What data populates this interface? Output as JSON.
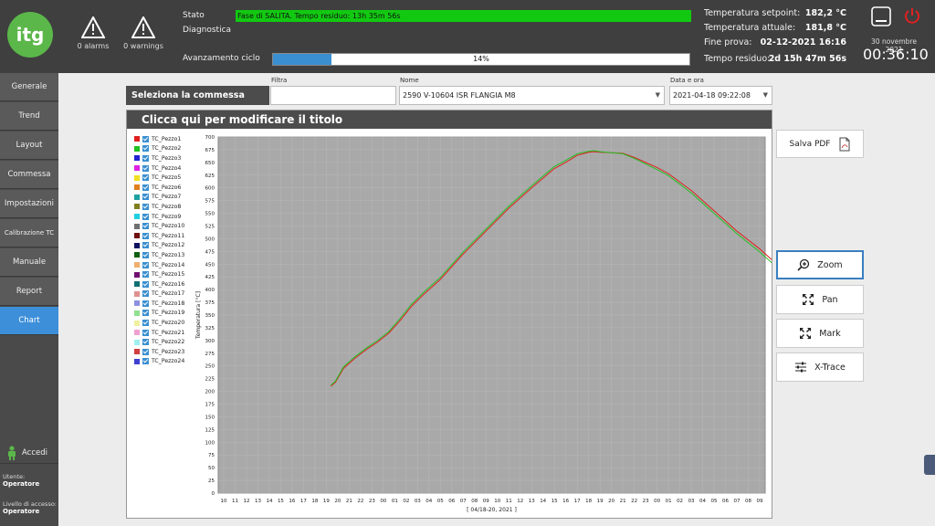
{
  "header": {
    "logo_text": "itg",
    "alarms": "0 alarms",
    "warnings": "0 warnings",
    "stato_label": "Stato",
    "stato_value": "Fase di SALITA. Tempo residuo: 13h 35m 56s",
    "diagnostica_label": "Diagnostica",
    "avanzamento_label": "Avanzamento ciclo",
    "progress_text": "14%",
    "progress_fraction": 0.14,
    "temps": [
      {
        "label": "Temperatura setpoint:",
        "value": "182,2 °C"
      },
      {
        "label": "Temperatura attuale:",
        "value": "181,8 °C"
      },
      {
        "label": "Fine prova:",
        "value": "02-12-2021 16:16"
      },
      {
        "label": "Tempo residuo:",
        "value": "2d 15h 47m 56s"
      }
    ],
    "date": "30 novembre 2021",
    "time": "00:36:10",
    "status_color": "#12c912",
    "progress_color": "#3a8fd0"
  },
  "sidebar": {
    "items": [
      {
        "label": "Generale"
      },
      {
        "label": "Trend"
      },
      {
        "label": "Layout"
      },
      {
        "label": "Commessa"
      },
      {
        "label": "Impostazioni"
      },
      {
        "label": "Calibrazione TC"
      },
      {
        "label": "Manuale"
      },
      {
        "label": "Report"
      },
      {
        "label": "Chart"
      }
    ],
    "active_color": "#3d8fd9",
    "login_label": "Accedi",
    "utente_label": "Utente:",
    "utente_value": "Operatore",
    "livello_label": "Livello di accesso:",
    "livello_value": "Operatore"
  },
  "selector": {
    "title": "Seleziona la commessa",
    "filtra_label": "Filtra",
    "filtra_value": "",
    "nome_label": "Nome",
    "nome_value": "2590 V-10604 ISR FLANGIA M8",
    "data_label": "Data e ora",
    "data_value": "2021-04-18 09:22:08"
  },
  "chart_panel": {
    "title": "Clicca qui per modificare il titolo",
    "legend": [
      {
        "name": "TC_Pezzo1",
        "color": "#e02020"
      },
      {
        "name": "TC_Pezzo2",
        "color": "#20c020"
      },
      {
        "name": "TC_Pezzo3",
        "color": "#2020d0"
      },
      {
        "name": "TC_Pezzo4",
        "color": "#e020e0"
      },
      {
        "name": "TC_Pezzo5",
        "color": "#f0e020"
      },
      {
        "name": "TC_Pezzo6",
        "color": "#e08020"
      },
      {
        "name": "TC_Pezzo7",
        "color": "#20a0a0"
      },
      {
        "name": "TC_Pezzo8",
        "color": "#808020"
      },
      {
        "name": "TC_Pezzo9",
        "color": "#20d0e0"
      },
      {
        "name": "TC_Pezzo10",
        "color": "#707070"
      },
      {
        "name": "TC_Pezzo11",
        "color": "#701010"
      },
      {
        "name": "TC_Pezzo12",
        "color": "#101060"
      },
      {
        "name": "TC_Pezzo13",
        "color": "#106010"
      },
      {
        "name": "TC_Pezzo14",
        "color": "#f0b070"
      },
      {
        "name": "TC_Pezzo15",
        "color": "#701070"
      },
      {
        "name": "TC_Pezzo16",
        "color": "#107070"
      },
      {
        "name": "TC_Pezzo17",
        "color": "#e09090"
      },
      {
        "name": "TC_Pezzo18",
        "color": "#9090e0"
      },
      {
        "name": "TC_Pezzo19",
        "color": "#90e090"
      },
      {
        "name": "TC_Pezzo20",
        "color": "#f0f0a0"
      },
      {
        "name": "TC_Pezzo21",
        "color": "#f0a0d0"
      },
      {
        "name": "TC_Pezzo22",
        "color": "#a0f0f0"
      },
      {
        "name": "TC_Pezzo23",
        "color": "#d04040"
      },
      {
        "name": "TC_Pezzo24",
        "color": "#4040d0"
      }
    ]
  },
  "chart_data": {
    "type": "line",
    "title": "",
    "xlabel": "[ 04/18-20, 2021 ]",
    "ylabel": "Temperatura [°C]",
    "ylim": [
      0,
      700
    ],
    "yticks": [
      0,
      25,
      50,
      75,
      100,
      125,
      150,
      175,
      200,
      225,
      250,
      275,
      300,
      325,
      350,
      375,
      400,
      425,
      450,
      475,
      500,
      525,
      550,
      575,
      600,
      625,
      650,
      675,
      700
    ],
    "xticks": [
      "10",
      "11",
      "12",
      "13",
      "14",
      "15",
      "16",
      "17",
      "18",
      "19",
      "20",
      "21",
      "22",
      "23",
      "00",
      "01",
      "02",
      "03",
      "04",
      "05",
      "06",
      "07",
      "08",
      "09",
      "10",
      "11",
      "12",
      "13",
      "14",
      "15",
      "16",
      "17",
      "18",
      "19",
      "20",
      "21",
      "22",
      "23",
      "00",
      "01",
      "02",
      "03",
      "04",
      "05",
      "06",
      "07",
      "08",
      "09"
    ],
    "grid": true,
    "background": "#a9a9a9",
    "series": [
      {
        "name": "TC_Pezzo1",
        "color": "#e02020",
        "x": [
          9.4,
          9.8,
          10.5,
          11.5,
          12.5,
          13.5,
          14.5,
          15.5,
          16.5,
          17.5,
          19,
          21,
          23,
          25,
          27,
          29,
          30,
          31,
          32,
          32.5,
          33,
          34,
          35,
          36,
          37,
          38,
          39,
          41,
          43,
          45,
          47,
          49,
          51,
          53,
          55,
          57
        ],
        "y": [
          210,
          218,
          245,
          265,
          282,
          297,
          315,
          340,
          368,
          390,
          420,
          470,
          515,
          560,
          600,
          638,
          650,
          664,
          670,
          671,
          670,
          669,
          668,
          660,
          650,
          640,
          628,
          595,
          555,
          515,
          480,
          440,
          405,
          370,
          340,
          305
        ]
      },
      {
        "name": "TC_Pezzo2",
        "color": "#20c020",
        "x": [
          9.4,
          9.8,
          10.5,
          11.5,
          12.5,
          13.5,
          14.5,
          15.5,
          16.5,
          17.5,
          19,
          21,
          23,
          25,
          27,
          29,
          30,
          31,
          32,
          32.5,
          33,
          34,
          35,
          36,
          37,
          38,
          39,
          41,
          43,
          45,
          47,
          49,
          51,
          53,
          55,
          57
        ],
        "y": [
          212,
          220,
          248,
          268,
          285,
          300,
          318,
          344,
          372,
          394,
          424,
          474,
          519,
          564,
          604,
          642,
          654,
          667,
          672,
          673,
          671,
          669,
          667,
          658,
          647,
          636,
          624,
          590,
          550,
          510,
          474,
          434,
          398,
          364,
          332,
          300
        ]
      }
    ]
  },
  "tools": {
    "save_pdf": "Salva PDF",
    "zoom": "Zoom",
    "pan": "Pan",
    "mark": "Mark",
    "xtrace": "X-Trace"
  }
}
